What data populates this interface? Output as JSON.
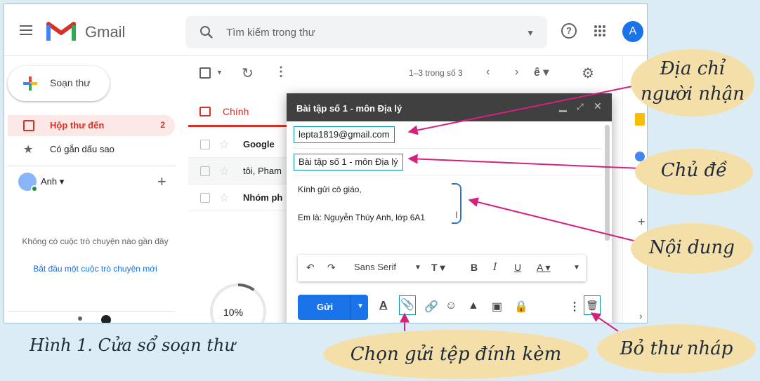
{
  "header": {
    "brand": "Gmail",
    "search_placeholder": "Tìm kiếm trong thư",
    "help_glyph": "?",
    "avatar_letter": "A"
  },
  "sidebar": {
    "compose_label": "Soạn thư",
    "items": [
      {
        "label": "Hộp thư đến",
        "count": "2"
      },
      {
        "label": "Có gắn dấu sao"
      }
    ],
    "user_name": "Anh",
    "no_chats": "Không có cuộc trò chuyện nào gần đây",
    "start_chat": "Bắt đầu một cuộc trò chuyện mới"
  },
  "toolbar": {
    "page_info": "1–3 trong số 3"
  },
  "tabs": [
    {
      "label": "Chính"
    }
  ],
  "email_list": [
    {
      "sender": "Google"
    },
    {
      "sender": "tôi, Pham"
    },
    {
      "sender": "Nhóm ph"
    }
  ],
  "storage": {
    "percent_label": "10%",
    "percent": 10
  },
  "compose": {
    "title": "Bài tập số 1 - môn Địa lý",
    "to": "lepta1819@gmail.com",
    "subject": "Bài tập số 1 - môn Địa lý",
    "body_line1": "Kính gửi cô giáo,",
    "body_line2": "Em là: Nguyễn Thúy Anh, lớp 6A1",
    "font": "Sans Serif",
    "send_label": "Gửi"
  },
  "callouts": {
    "recipient_line1": "Địa chỉ",
    "recipient_line2": "người nhận",
    "subject": "Chủ đề",
    "content": "Nội dung",
    "attach": "Chọn gửi tệp đính kèm",
    "discard": "Bỏ thư nháp"
  },
  "caption": "Hình 1. Cửa sổ soạn thư",
  "colors": {
    "accent_red": "#d93025",
    "gmail_blue": "#1a73e8",
    "callout_fill": "#f5dfa8",
    "arrow_magenta": "#d6207e",
    "highlight_border": "#0097a7"
  }
}
